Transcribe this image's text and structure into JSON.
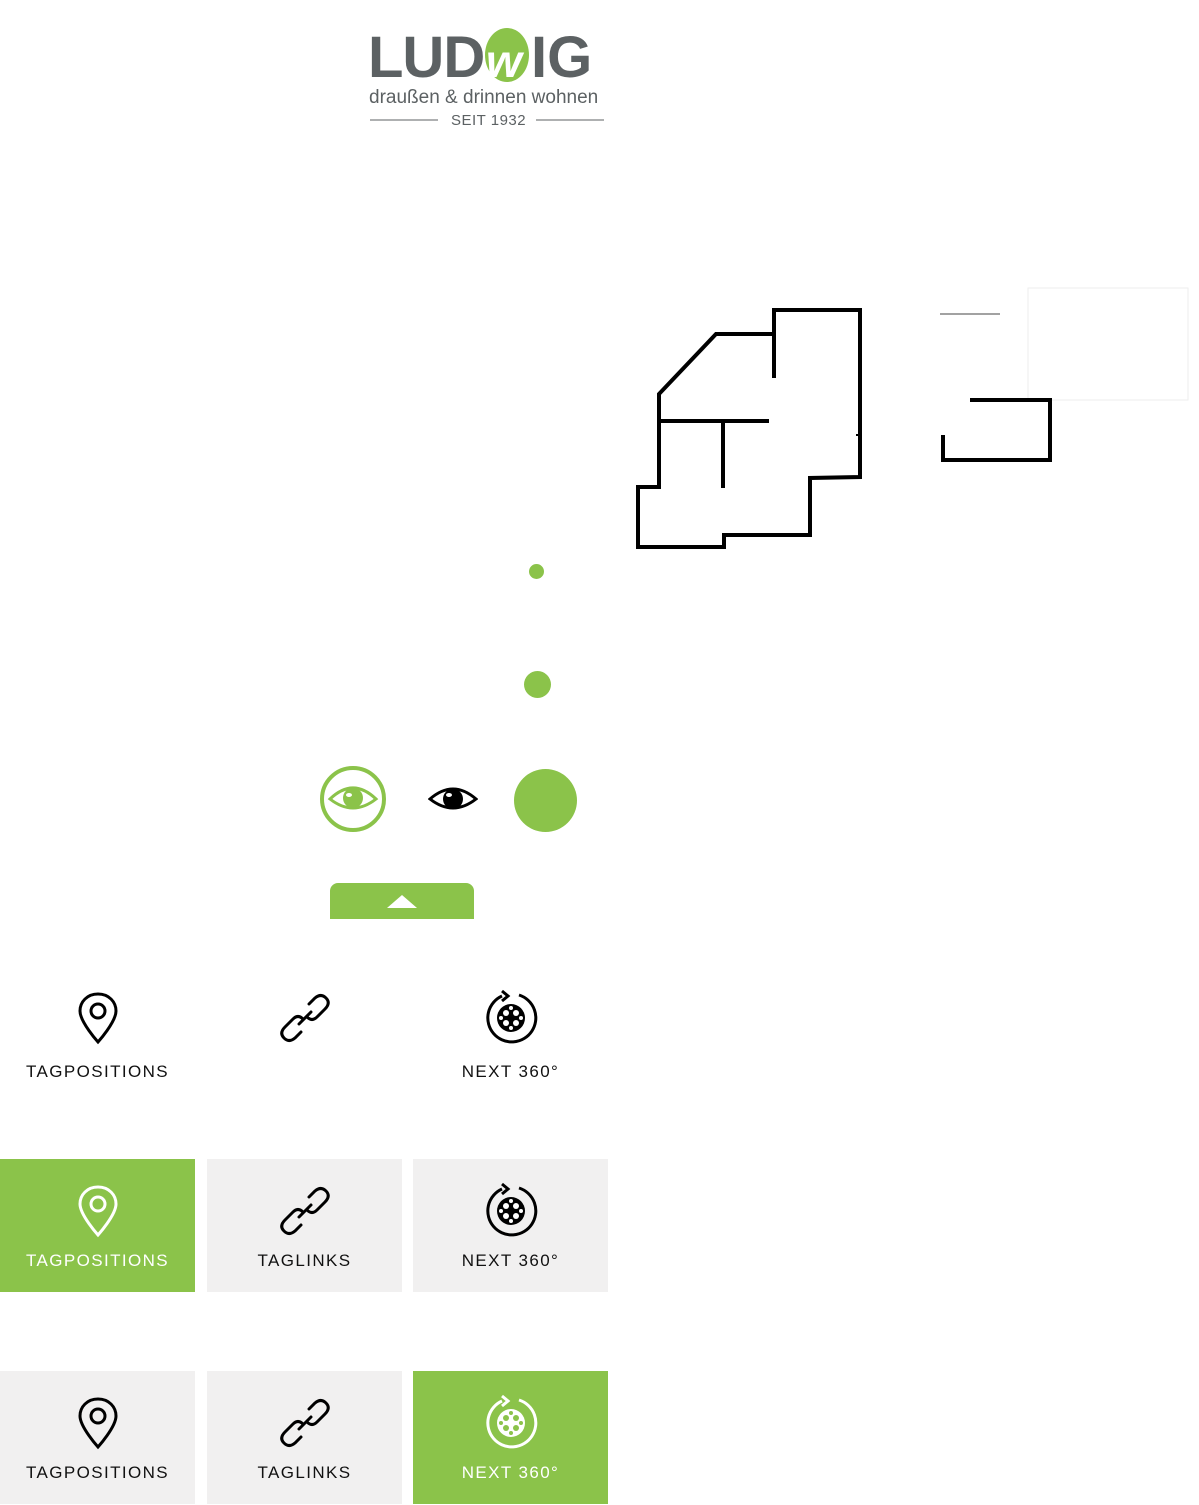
{
  "logo": {
    "brand": "LUDWIG",
    "tagline": "draußen & drinnen wohnen",
    "since": "SEIT 1932",
    "text_color": "#5c6163",
    "accent": "#8bc34a"
  },
  "colors": {
    "accent": "#8bc34a",
    "tile_grey": "#f1f0f0",
    "text": "#111111"
  },
  "icons": {
    "eye_active": "eye-ring-icon",
    "eye_plain": "eye-icon",
    "collapse": "chevron-up-icon",
    "tagpositions": "map-pin-icon",
    "taglinks": "link-icon",
    "next360": "rotate-360-icon"
  },
  "rows": [
    {
      "tiles": [
        {
          "label": "TAGPOSITIONS",
          "state": "plain"
        },
        {
          "label": "",
          "state": "plain"
        },
        {
          "label": "NEXT 360°",
          "state": "plain"
        }
      ]
    },
    {
      "tiles": [
        {
          "label": "TAGPOSITIONS",
          "state": "active"
        },
        {
          "label": "TAGLINKS",
          "state": "grey"
        },
        {
          "label": "NEXT 360°",
          "state": "grey"
        }
      ]
    },
    {
      "tiles": [
        {
          "label": "TAGPOSITIONS",
          "state": "grey"
        },
        {
          "label": "TAGLINKS",
          "state": "grey"
        },
        {
          "label": "NEXT 360°",
          "state": "active"
        }
      ]
    }
  ]
}
